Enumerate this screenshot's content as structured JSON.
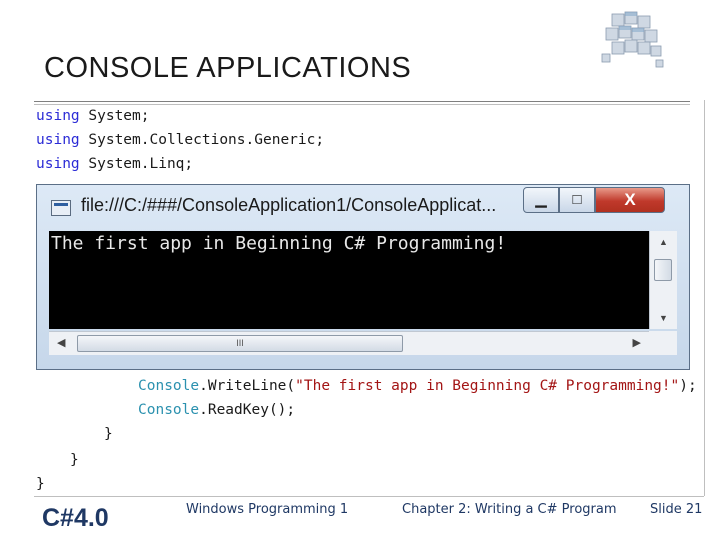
{
  "slide": {
    "title": "CONSOLE APPLICATIONS"
  },
  "code_top": [
    {
      "kw": "using",
      "rest": " System;"
    },
    {
      "kw": "using",
      "rest": " System.Collections.Generic;"
    },
    {
      "kw": "using",
      "rest": " System.Linq;"
    }
  ],
  "code_bottom": {
    "line1": {
      "type": "Console",
      "method": ".WriteLine(",
      "str": "\"The first app in Beginning C# Programming!\"",
      "end": ");"
    },
    "line2": {
      "type": "Console",
      "rest": ".ReadKey();"
    },
    "brace1": "}",
    "brace2": "}",
    "brace3": "}"
  },
  "console_window": {
    "title": "file:///C:/###/ConsoleApplication1/ConsoleApplicat...",
    "minimize_label": "▁",
    "maximize_label": "□",
    "close_label": "X",
    "output": "The first app in Beginning C# Programming!",
    "scroll_thumb_label": "III"
  },
  "footer": {
    "left": "C#4.0",
    "course": "Windows Programming 1",
    "chapter_prefix": "Chapter 2: Writing a C# Program",
    "slide_number": "Slide 21"
  },
  "icons": {
    "logo": "cube-stack-icon",
    "window": "console-window-icon"
  }
}
